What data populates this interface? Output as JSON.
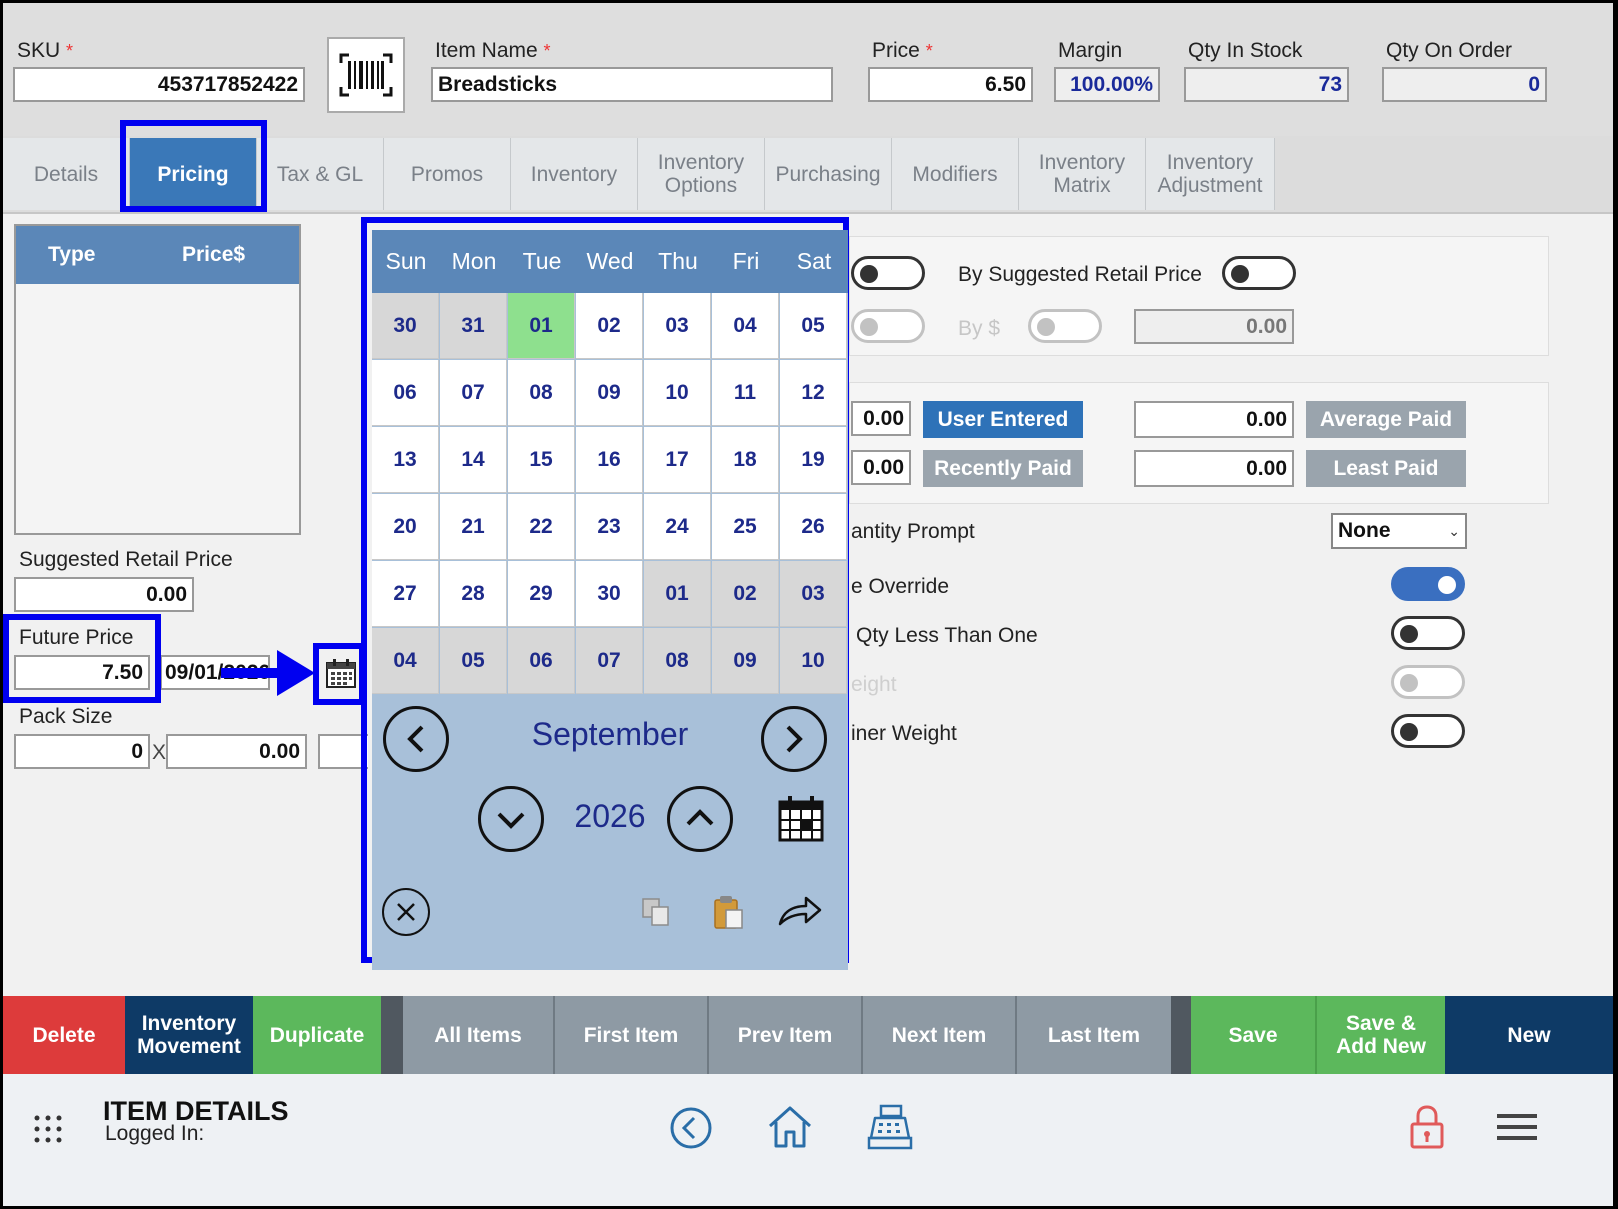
{
  "header": {
    "sku_label": "SKU",
    "sku_value": "453717852422",
    "item_name_label": "Item Name",
    "item_name_value": "Breadsticks",
    "price_label": "Price",
    "price_value": "6.50",
    "margin_label": "Margin",
    "margin_value": "100.00%",
    "qty_in_stock_label": "Qty In Stock",
    "qty_in_stock_value": "73",
    "qty_on_order_label": "Qty On Order",
    "qty_on_order_value": "0",
    "required_mark": "*"
  },
  "tabs": [
    {
      "label": "Details"
    },
    {
      "label": "Pricing"
    },
    {
      "label": "Tax & GL"
    },
    {
      "label": "Promos"
    },
    {
      "label": "Inventory"
    },
    {
      "label": "Inventory\nOptions"
    },
    {
      "label": "Purchasing"
    },
    {
      "label": "Modifiers"
    },
    {
      "label": "Inventory\nMatrix"
    },
    {
      "label": "Inventory\nAdjustment"
    }
  ],
  "price_table": {
    "col_type": "Type",
    "col_price": "Price$"
  },
  "left": {
    "suggested_retail_label": "Suggested Retail Price",
    "suggested_retail_value": "0.00",
    "future_price_label": "Future Price",
    "future_price_value": "7.50",
    "future_price_date": "09/01/2026",
    "pack_size_label": "Pack Size",
    "pack_qty": "0",
    "pack_x": "X",
    "pack_price": "0.00"
  },
  "right": {
    "by_suggested_label": "By Suggested Retail Price",
    "by_dollar_label": "By $",
    "by_dollar_value": "0.00",
    "cost_field_1": "0.00",
    "cost_field_2": "0.00",
    "user_entered_label": "User Entered",
    "recently_paid_label": "Recently Paid",
    "avg_paid_value": "0.00",
    "least_paid_value": "0.00",
    "average_paid_label": "Average Paid",
    "least_paid_label": "Least Paid",
    "quantity_prompt_label": "antity Prompt",
    "quantity_prompt_value": "None",
    "override_label": "e Override",
    "qty_less_label": "Qty Less Than One",
    "weight_label": "eight",
    "tiner_weight_label": "iner Weight"
  },
  "calendar": {
    "weekdays": [
      "Sun",
      "Mon",
      "Tue",
      "Wed",
      "Thu",
      "Fri",
      "Sat"
    ],
    "days": [
      [
        "30",
        "31",
        "01",
        "02",
        "03",
        "04",
        "05"
      ],
      [
        "06",
        "07",
        "08",
        "09",
        "10",
        "11",
        "12"
      ],
      [
        "13",
        "14",
        "15",
        "16",
        "17",
        "18",
        "19"
      ],
      [
        "20",
        "21",
        "22",
        "23",
        "24",
        "25",
        "26"
      ],
      [
        "27",
        "28",
        "29",
        "30",
        "01",
        "02",
        "03"
      ],
      [
        "04",
        "05",
        "06",
        "07",
        "08",
        "09",
        "10"
      ]
    ],
    "month": "September",
    "year": "2026",
    "selected_color": "#8ee08e",
    "header_color": "#5b87b8"
  },
  "actions": [
    {
      "label": "Delete",
      "color": "#dd3b3b"
    },
    {
      "label": "Inventory\nMovement",
      "color": "#0e3a66"
    },
    {
      "label": "Duplicate",
      "color": "#5cb85c"
    },
    {
      "label": "All Items",
      "color": "#8e9aa4"
    },
    {
      "label": "First Item",
      "color": "#8e9aa4"
    },
    {
      "label": "Prev Item",
      "color": "#8e9aa4"
    },
    {
      "label": "Next Item",
      "color": "#8e9aa4"
    },
    {
      "label": "Last Item",
      "color": "#8e9aa4"
    },
    {
      "label": "Save",
      "color": "#5cb85c"
    },
    {
      "label": "Save &\nAdd New",
      "color": "#5cb85c"
    },
    {
      "label": "New",
      "color": "#0e3a66"
    }
  ],
  "footer": {
    "title": "ITEM DETAILS",
    "subtitle": "Logged In:"
  },
  "icons": {
    "barcode": "barcode-icon",
    "calendar": "calendar-icon",
    "back": "back-arrow-icon",
    "home": "home-icon",
    "register": "cash-register-icon",
    "lock": "lock-icon",
    "menu": "hamburger-menu-icon",
    "apps": "apps-grid-icon"
  },
  "colors": {
    "accent": "#3a78b8",
    "highlight": "#0000f0"
  }
}
